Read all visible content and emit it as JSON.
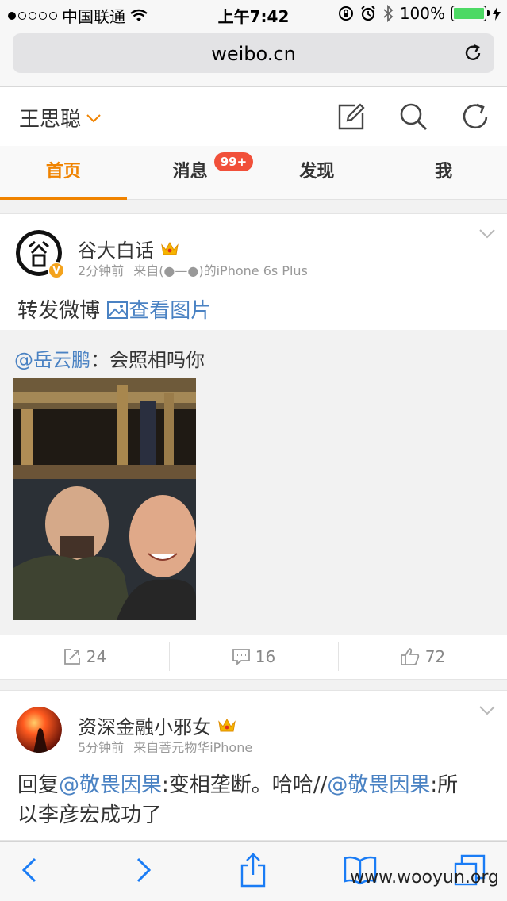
{
  "status_bar": {
    "carrier": "中国联通",
    "time": "上午7:42",
    "battery": "100%"
  },
  "browser": {
    "url": "weibo.cn"
  },
  "header": {
    "title": "王思聪"
  },
  "tabs": [
    {
      "label": "首页",
      "active": true
    },
    {
      "label": "消息",
      "badge": "99+"
    },
    {
      "label": "发现"
    },
    {
      "label": "我"
    }
  ],
  "posts": [
    {
      "author": "谷大白话",
      "time": "2分钟前",
      "source": "来自(●—●)的iPhone 6s Plus",
      "text": "转发微博",
      "image_link": "查看图片",
      "repost": {
        "mention": "@岳云鹏",
        "text": "：会照相吗你"
      },
      "reposts": "24",
      "comments": "16",
      "likes": "72"
    },
    {
      "author": "资深金融小邪女",
      "time": "5分钟前",
      "source": "来自菩元物华iPhone",
      "text_parts": {
        "p1": "回复",
        "mention1": "@敬畏因果",
        "p2": ":变相垄断。哈哈//",
        "mention2": "@敬畏因果",
        "p3": ":所",
        "line2": "以李彦宏成功了"
      }
    }
  ],
  "watermark": "www.wooyun.org",
  "colors": {
    "accent": "#f08300",
    "link": "#4a82c3",
    "badge": "#f1503a",
    "ios_blue": "#1a7cf5"
  }
}
